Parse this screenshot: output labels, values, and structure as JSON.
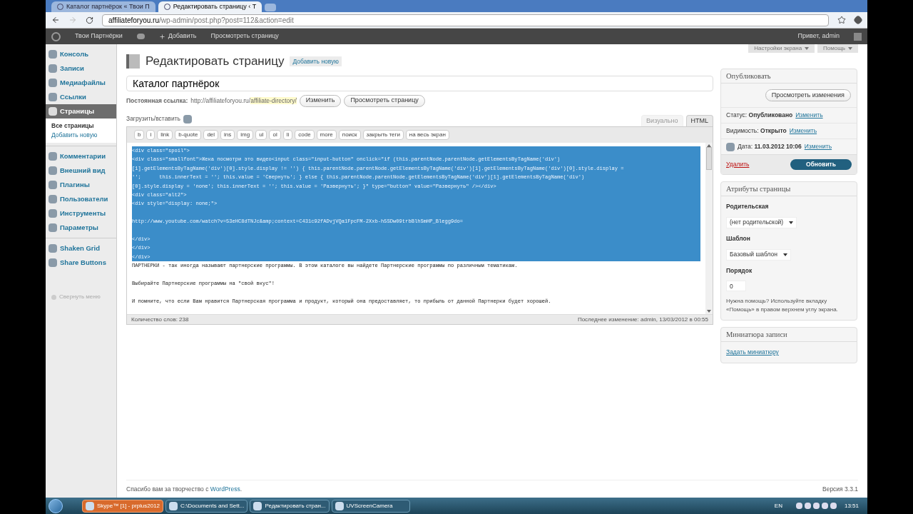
{
  "browser": {
    "tabs": [
      {
        "label": "Каталог партнёрок « Твои П",
        "selected": false
      },
      {
        "label": "Редактировать страницу ‹ Т",
        "selected": true
      }
    ],
    "url_host": "affiliateforyou.ru",
    "url_path": "/wp-admin/post.php?post=112&action=edit"
  },
  "admin_bar": {
    "items": [
      "Твои Партнёрки",
      "Добавить",
      "Просмотреть страницу"
    ],
    "greeting": "Привет, admin"
  },
  "sidebar": {
    "items": [
      {
        "label": "Консоль",
        "selected": false
      },
      {
        "label": "Записи",
        "selected": false
      },
      {
        "label": "Медиафайлы",
        "selected": false
      },
      {
        "label": "Ссылки",
        "selected": false
      },
      {
        "label": "Страницы",
        "selected": true,
        "children": [
          {
            "label": "Все страницы",
            "selected": true
          },
          {
            "label": "Добавить новую",
            "selected": false
          }
        ]
      },
      {
        "label": "Комментарии",
        "selected": false
      },
      {
        "label": "Внешний вид",
        "selected": false
      },
      {
        "label": "Плагины",
        "selected": false
      },
      {
        "label": "Пользователи",
        "selected": false
      },
      {
        "label": "Инструменты",
        "selected": false
      },
      {
        "label": "Параметры",
        "selected": false
      },
      {
        "label": "Shaken Grid",
        "selected": false
      },
      {
        "label": "Share Buttons",
        "selected": false
      }
    ],
    "collapse": "Свернуть меню"
  },
  "screen_options": [
    "Настройки экрана",
    "Помощь"
  ],
  "page": {
    "title": "Редактировать страницу",
    "add_new": "Добавить новую",
    "post_title": "Каталог партнёрок",
    "permalink": {
      "label": "Постоянная ссылка:",
      "base": "http://affiliateforyou.ru/",
      "slug": "affiliate-directory/",
      "buttons": [
        "Изменить",
        "Просмотреть страницу"
      ]
    },
    "upload": "Загрузить/вставить",
    "editor_tabs": [
      {
        "label": "Визуально",
        "selected": false
      },
      {
        "label": "HTML",
        "selected": true
      }
    ],
    "quicktags": [
      "b",
      "i",
      "link",
      "b-quote",
      "del",
      "ins",
      "img",
      "ul",
      "ol",
      "li",
      "code",
      "more",
      "поиск",
      "закрыть теги",
      "на весь экран"
    ],
    "lines": [
      {
        "text": "<div class=\"spoil\">",
        "selected": true,
        "gap_before": false
      },
      {
        "text": "<div class=\"smallfont\">Жека посмотри это видео<input class=\"input-button\" onclick=\"if (this.parentNode.parentNode.getElementsByTagName('div')",
        "selected": true,
        "gap_before": false
      },
      {
        "text": "[1].getElementsByTagName('div')[0].style.display != '') { this.parentNode.parentNode.getElementsByTagName('div')[1].getElementsByTagName('div')[0].style.display =",
        "selected": true,
        "gap_before": false
      },
      {
        "text": "'';      this.innerText = ''; this.value = 'Свернуть'; } else { this.parentNode.parentNode.getElementsByTagName('div')[1].getElementsByTagName('div')",
        "selected": true,
        "gap_before": false
      },
      {
        "text": "[0].style.display = 'none'; this.innerText = ''; this.value = 'Развернуть'; }\" type=\"button\" value=\"Развернуть\" /></div>",
        "selected": true,
        "gap_before": false
      },
      {
        "text": "<div class=\"alt2\">",
        "selected": true,
        "gap_before": false
      },
      {
        "text": "<div style=\"display: none;\">",
        "selected": true,
        "gap_before": false
      },
      {
        "text": "http://www.youtube.com/watch?v=53eHC8dTNJc&amp;context=C431c92fADvjVQa1FpcFM-2Xxb-h5SDw09trbBlhSmHP_Blegg9do=",
        "selected": true,
        "gap_before": true
      },
      {
        "text": "</div>",
        "selected": true,
        "gap_before": true
      },
      {
        "text": "</div>",
        "selected": true,
        "gap_before": false
      },
      {
        "text": "</div>",
        "selected": true,
        "gap_before": false
      },
      {
        "text": "ПАРТНЕРКИ - так иногда называют партнерские программы. В этом каталоге вы найдете Партнерские программы по различным тематикам.",
        "selected": false,
        "gap_before": false
      },
      {
        "text": "Выбирайте Партнерские программы на \"свой вкус\"!",
        "selected": false,
        "gap_before": true
      },
      {
        "text": "И помните, что если Вам нравится Партнерская программа и продукт, который она предоставляет, то прибыль от данной Партнерки будет хорошей.",
        "selected": false,
        "gap_before": true
      }
    ],
    "word_count": "Количество слов: 238",
    "last_edit": "Последнее изменение: admin, 13/03/2012 в 00:55"
  },
  "publish": {
    "title": "Опубликовать",
    "preview": "Просмотреть изменения",
    "rows": [
      {
        "label": "Статус:",
        "value": "Опубликовано",
        "link": "Изменить",
        "kind": "status"
      },
      {
        "label": "Видимость:",
        "value": "Открыто",
        "link": "Изменить",
        "kind": "visibility"
      },
      {
        "label": "Дата:",
        "value": "11.03.2012 10:06",
        "link": "Изменить",
        "kind": "date"
      }
    ],
    "delete": "Удалить",
    "update": "Обновить"
  },
  "attributes": {
    "title": "Атрибуты страницы",
    "parent_label": "Родительская",
    "parent": "(нет родительской)",
    "template_label": "Шаблон",
    "template": "Базовый шаблон",
    "order_label": "Порядок",
    "order": "0",
    "help": "Нужна помощь? Используйте вкладку «Помощь» в правом верхнем углу экрана."
  },
  "thumbnail": {
    "title": "Миниатюра записи",
    "link": "Задать миниатюру"
  },
  "footer": {
    "thanks": "Спасибо вам за творчество с ",
    "wp": "WordPress",
    "end": ".",
    "version": "Версия 3.3.1"
  },
  "taskbar": {
    "items": [
      {
        "label": "Skype™ [1] - prplus2012",
        "selected": true
      },
      {
        "label": "C:\\Documents and Sett...",
        "selected": false
      },
      {
        "label": "Редактировать стран...",
        "selected": false
      },
      {
        "label": "UVScreenCamera",
        "selected": false
      }
    ],
    "lang": "EN",
    "time": "13:51"
  }
}
